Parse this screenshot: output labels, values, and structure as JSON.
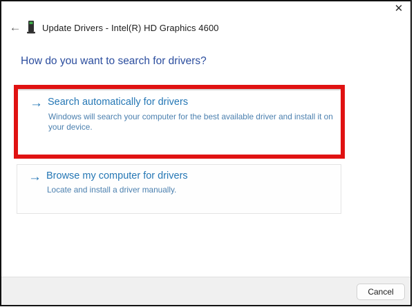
{
  "titlebar": {
    "close_glyph": "✕"
  },
  "header": {
    "back_glyph": "←",
    "title": "Update Drivers - Intel(R) HD Graphics 4600"
  },
  "heading": "How do you want to search for drivers?",
  "options": [
    {
      "arrow_glyph": "→",
      "title": "Search automatically for drivers",
      "description": "Windows will search your computer for the best available driver and install it on your device.",
      "highlighted": true
    },
    {
      "arrow_glyph": "→",
      "title": "Browse my computer for drivers",
      "description": "Locate and install a driver manually.",
      "highlighted": false
    }
  ],
  "footer": {
    "cancel_label": "Cancel"
  },
  "colors": {
    "heading_blue": "#2b4d9e",
    "link_blue": "#2577b5",
    "desc_blue": "#4a7fae",
    "highlight_red": "#e01212"
  }
}
